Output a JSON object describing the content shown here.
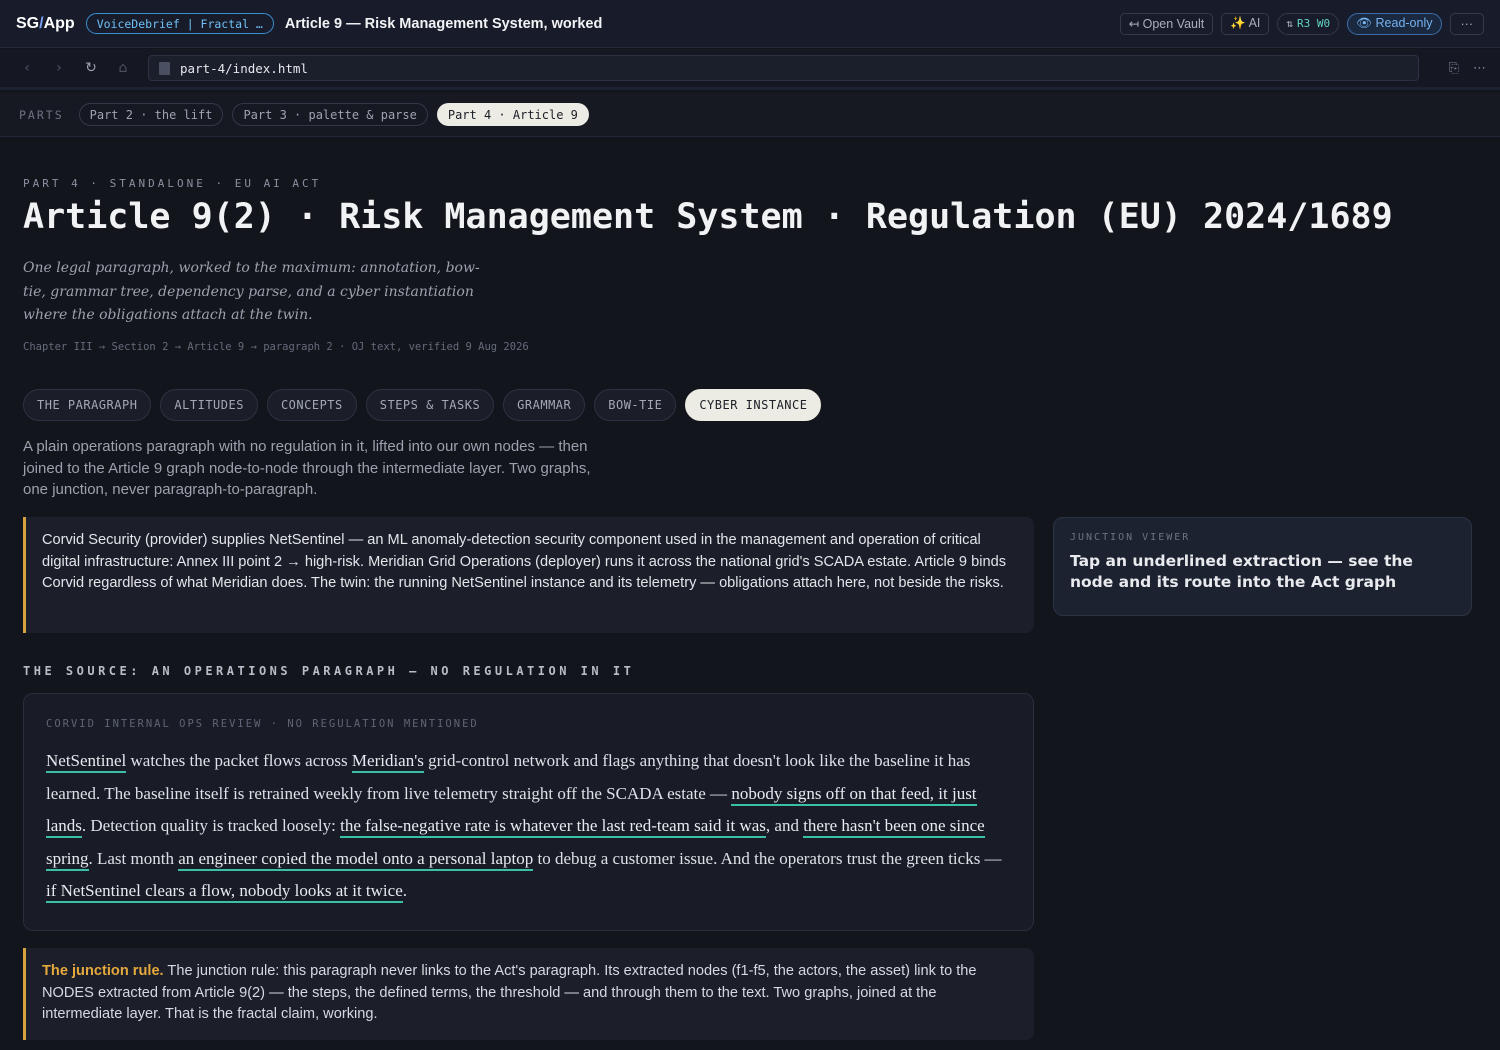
{
  "app": {
    "brand_left": "SG",
    "brand_slash": "/",
    "brand_right": "App",
    "project": "VoiceDebrief | Fractal …",
    "doc_title": "Article 9 — Risk Management System, worked",
    "actions": {
      "open_vault": "↤ Open Vault",
      "ai": "✨ AI",
      "sync_prefix": "⇅",
      "sync_value": "R3 W0",
      "readonly": "👁 Read-only",
      "more": "···"
    }
  },
  "browser": {
    "back": "‹",
    "forward": "›",
    "reload": "↻",
    "home": "⌂",
    "url": "part-4/index.html",
    "copy": "⎘",
    "more": "⋯"
  },
  "parts": {
    "label": "PARTS",
    "tabs": [
      {
        "label": "Part 2 · the lift"
      },
      {
        "label": "Part 3 · palette & parse"
      },
      {
        "label": "Part 4 · Article 9"
      }
    ]
  },
  "header": {
    "eyebrow": "PART 4 · STANDALONE · EU AI ACT",
    "title": "Article 9(2) · Risk Management System · Regulation (EU) 2024/1689",
    "subtitle": "One legal paragraph, worked to the maximum: annotation, bow-tie, grammar tree, dependency parse, and a cyber instantiation where the obligations attach at the twin.",
    "breadcrumb": "Chapter III → Section 2 → Article 9 → paragraph 2 · OJ text, verified 9 Aug 2026"
  },
  "section_tabs": [
    {
      "label": "THE PARAGRAPH"
    },
    {
      "label": "ALTITUDES"
    },
    {
      "label": "CONCEPTS"
    },
    {
      "label": "STEPS & TASKS"
    },
    {
      "label": "GRAMMAR"
    },
    {
      "label": "BOW-TIE"
    },
    {
      "label": "CYBER INSTANCE"
    }
  ],
  "lede": "A plain operations paragraph with no regulation in it, lifted into our own nodes — then joined to the Article 9 graph node-to-node through the intermediate layer. Two graphs, one junction, never paragraph-to-paragraph.",
  "scenario": "Corvid Security (provider) supplies NetSentinel — an ML anomaly-detection security component used in the management and operation of critical digital infrastructure: Annex III point 2 → high-risk. Meridian Grid Operations (deployer) runs it across the national grid's SCADA estate. Article 9 binds Corvid regardless of what Meridian does. The twin: the running NetSentinel instance and its telemetry — obligations attach here, not beside the risks.",
  "junction": {
    "label": "JUNCTION VIEWER",
    "text": "Tap an underlined extraction — see the node and its route into the Act graph"
  },
  "source": {
    "heading": "THE SOURCE: AN OPERATIONS PARAGRAPH — NO REGULATION IN IT",
    "card_label": "CORVID INTERNAL OPS REVIEW · NO REGULATION MENTIONED",
    "segments": {
      "e1": "NetSentinel",
      "t1": " watches the packet flows across ",
      "e2": "Meridian's",
      "t2": " grid-control network and flags anything that doesn't look like the baseline it has learned. The baseline itself is retrained weekly from live telemetry straight off the SCADA estate — ",
      "e3": "nobody signs off on that feed, it just lands",
      "t3": ". Detection quality is tracked loosely: ",
      "e4": "the false-negative rate is whatever the last red-team said it was",
      "t4": ", and ",
      "e5": "there hasn't been one since spring",
      "t5": ". Last month ",
      "e6": "an engineer copied the model onto a personal laptop",
      "t6": " to debug a customer issue. And the operators trust the green ticks — ",
      "e7": "if NetSentinel clears a flow, nobody looks at it twice",
      "t7": "."
    }
  },
  "rule": {
    "lead": "The junction rule.",
    "text": " The junction rule: this paragraph never links to the Act's paragraph. Its extracted nodes (f1-f5, the actors, the asset) link to the NODES extracted from Article 9(2) — the steps, the defined terms, the threshold — and through them to the text. Two graphs, joined at the intermediate layer. That is the fractal claim, working."
  }
}
